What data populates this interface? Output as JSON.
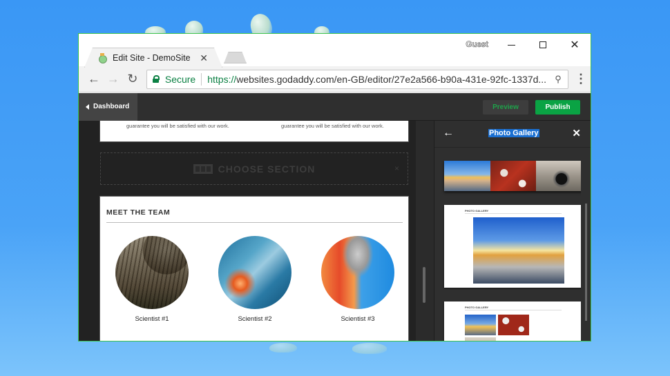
{
  "browser": {
    "tab_title": "Edit Site - DemoSite",
    "tab_close_glyph": "✕",
    "profile_label": "Guest",
    "close_glyph": "✕",
    "nav_back_glyph": "←",
    "nav_forward_glyph": "→",
    "reload_glyph": "↻",
    "secure_label": "Secure",
    "url_scheme": "https://",
    "url_rest": "websites.godaddy.com/en-GB/editor/27e2a566-b90a-431e-92fc-1337d...",
    "zoom_glyph": "🔍",
    "menu_glyph": "⋮"
  },
  "editor": {
    "dashboard_label": "Dashboard",
    "preview_label": "Preview",
    "publish_label": "Publish",
    "colors": {
      "publish": "#0aa344",
      "preview_text": "#1ea34a",
      "selection": "#1a6fd1"
    }
  },
  "canvas": {
    "guarantee_text_1": "guarantee you will be satisfied with our work.",
    "guarantee_text_2": "guarantee you will be satisfied with our work.",
    "choose_section_label": "CHOOSE SECTION",
    "choose_section_close": "×",
    "team": {
      "title": "MEET THE TEAM",
      "members": [
        {
          "name": "Scientist #1"
        },
        {
          "name": "Scientist #2"
        },
        {
          "name": "Scientist #3"
        }
      ]
    },
    "add_glyph": "+"
  },
  "panel": {
    "back_glyph": "←",
    "title": "Photo Gallery",
    "close_glyph": "✕",
    "layouts": [
      {
        "title": "PHOTO GALLERY"
      },
      {
        "title": "PHOTO GALLERY"
      }
    ]
  }
}
